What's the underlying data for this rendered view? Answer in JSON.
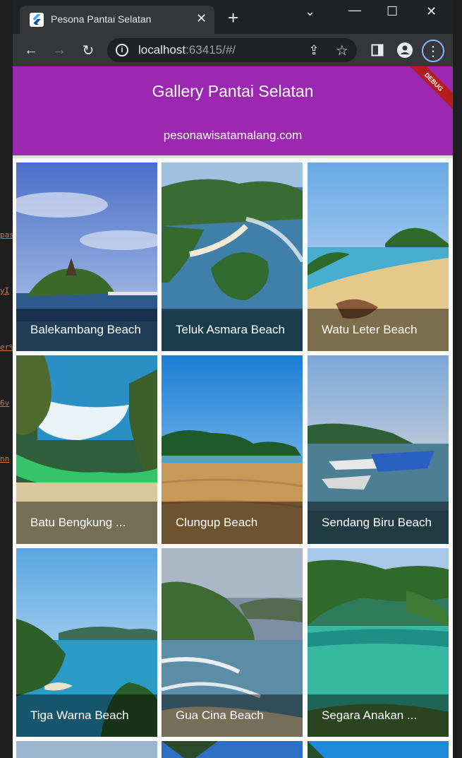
{
  "browser": {
    "tab_title": "Pesona Pantai Selatan",
    "url_host": "localhost",
    "url_rest": ":63415/#/"
  },
  "app": {
    "title": "Gallery Pantai Selatan",
    "subtitle": "pesonawisatamalang.com",
    "debug_banner": "DEBUG",
    "primary_color": "#9c27b0"
  },
  "gallery": [
    {
      "name": "Balekambang Beach"
    },
    {
      "name": "Teluk Asmara Beach"
    },
    {
      "name": "Watu Leter Beach"
    },
    {
      "name": "Batu Bengkung ..."
    },
    {
      "name": "Clungup Beach"
    },
    {
      "name": "Sendang Biru Beach"
    },
    {
      "name": "Tiga Warna Beach"
    },
    {
      "name": "Gua Cina Beach"
    },
    {
      "name": "Segara Anakan ..."
    }
  ]
}
